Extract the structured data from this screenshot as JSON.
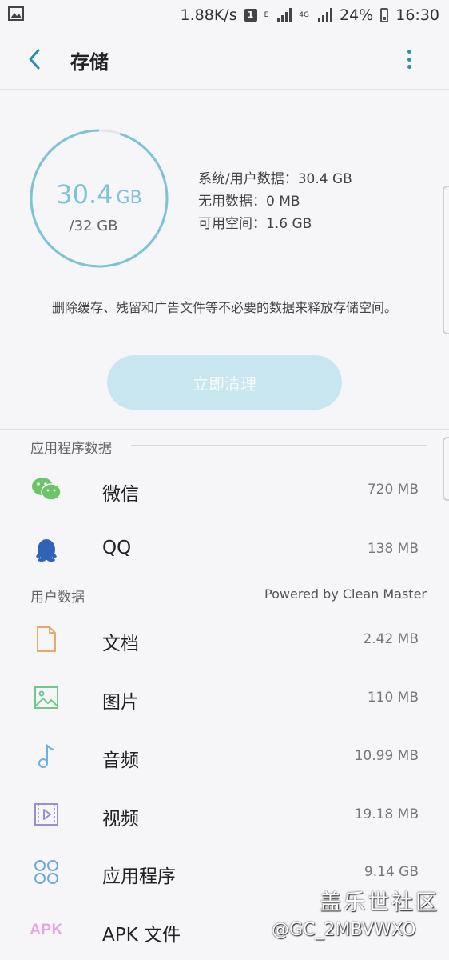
{
  "status_bar": {
    "speed": "1.88K/s",
    "sim_badge": "1",
    "network_e": "E",
    "network_4g": "4G",
    "battery": "24%",
    "time": "16:30"
  },
  "app_bar": {
    "title": "存储",
    "back_icon": "chevron-left-icon",
    "more_icon": "more-vert-icon"
  },
  "storage": {
    "used": "30.4",
    "used_unit": "GB",
    "total": "/32 GB",
    "used_fraction": 0.95,
    "ring_color": "#7cc3d4",
    "system_user": "系统/用户数据：30.4 GB",
    "junk": "无用数据：0 MB",
    "available": "可用空间：1.6 GB",
    "description": "删除缓存、残留和广告文件等不必要的数据来释放存储空间。",
    "clean_button": "立即清理"
  },
  "app_data": {
    "header": "应用程序数据",
    "items": [
      {
        "label": "微信",
        "size": "720 MB",
        "icon": "wechat-icon"
      },
      {
        "label": "QQ",
        "size": "138 MB",
        "icon": "qq-penguin-icon"
      }
    ]
  },
  "user_data": {
    "header": "用户数据",
    "powered": "Powered by Clean Master",
    "items": [
      {
        "label": "文档",
        "size": "2.42 MB",
        "icon": "document-icon"
      },
      {
        "label": "图片",
        "size": "110 MB",
        "icon": "image-icon"
      },
      {
        "label": "音频",
        "size": "10.99 MB",
        "icon": "music-note-icon"
      },
      {
        "label": "视频",
        "size": "19.18 MB",
        "icon": "video-icon"
      },
      {
        "label": "应用程序",
        "size": "9.14 GB",
        "icon": "apps-grid-icon"
      },
      {
        "label": "APK 文件",
        "size": "",
        "icon": "apk-icon",
        "icon_text": "APK"
      }
    ]
  },
  "watermark": {
    "line1": "盖乐世社区",
    "line2": "@GC_2MBVWXO"
  }
}
